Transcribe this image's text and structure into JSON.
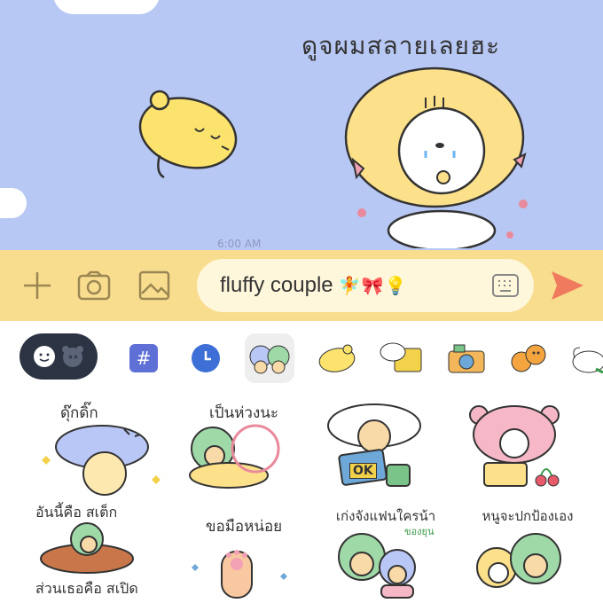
{
  "chat": {
    "sticker_caption": "ดูจผมสลายเลยฮะ",
    "timestamp": "6:00 AM"
  },
  "input_bar": {
    "message_text": "fluffy couple",
    "message_emoji": "🧚🎀💡",
    "icons": [
      "plus-icon",
      "camera-icon",
      "image-icon",
      "keyboard-icon",
      "send-icon"
    ]
  },
  "tray": {
    "tabs": [
      {
        "name": "emoji-tab",
        "icon": "face-icon"
      },
      {
        "name": "hashtag-tab",
        "label": "#"
      },
      {
        "name": "recent-tab",
        "icon": "clock-icon"
      },
      {
        "name": "sticker-pack-bears",
        "selected": true
      },
      {
        "name": "sticker-pack-tiger"
      },
      {
        "name": "sticker-pack-tv"
      },
      {
        "name": "sticker-pack-camera"
      },
      {
        "name": "sticker-pack-cookies"
      },
      {
        "name": "sticker-pack-rabbit"
      }
    ]
  },
  "stickers": [
    {
      "caption": "ดุ๊กดิ๊ก"
    },
    {
      "caption": "เป็นห่วงนะ"
    },
    {
      "caption": "",
      "badge": "OK"
    },
    {
      "caption": ""
    },
    {
      "caption": "อันนี้คือ สเต็ก",
      "caption2": "ส่วนเธอคือ สเปิด"
    },
    {
      "caption": "ขอมือหน่อย"
    },
    {
      "caption": "เก่งจังแฟนใครน้า",
      "caption2": "ของยุน"
    },
    {
      "caption": "หนูจะปกป้องเอง"
    }
  ],
  "colors": {
    "chat_bg": "#b8c8f4",
    "input_bar_bg": "#f9dd8e",
    "send_accent": "#f07a5e",
    "selected_tab_bg": "#eeeeee"
  }
}
